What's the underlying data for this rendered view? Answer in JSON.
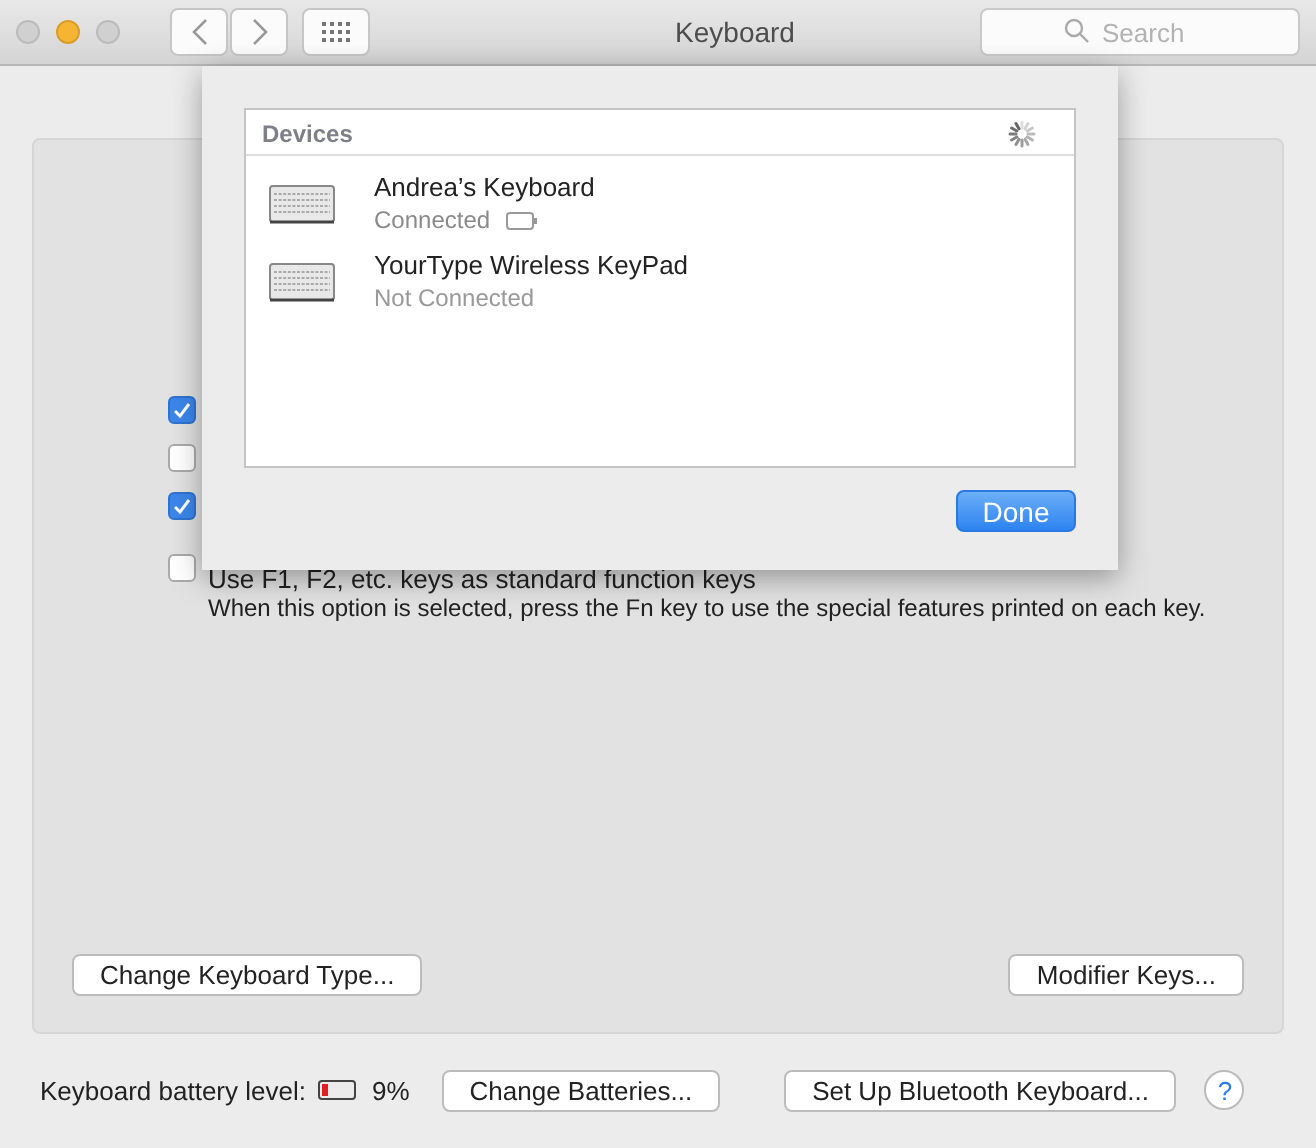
{
  "window": {
    "title": "Keyboard"
  },
  "search": {
    "placeholder": "Search"
  },
  "options": [
    {
      "checked": true
    },
    {
      "checked": false
    },
    {
      "checked": true
    },
    {
      "checked": false,
      "label": "Use F1, F2, etc. keys as standard function keys",
      "note": "When this option is selected, press the Fn key to use the special features printed on each key."
    }
  ],
  "panel_buttons": [
    "Change Keyboard Type...",
    "Modifier Keys..."
  ],
  "battery": {
    "label": "Keyboard battery level:",
    "level": 0.09,
    "reading": "9%"
  },
  "footer_buttons": [
    "Change Batteries...",
    "Set Up Bluetooth Keyboard..."
  ],
  "help": "?",
  "sheet": {
    "list_title": "Devices",
    "devices": [
      {
        "name": "Andrea’s Keyboard",
        "status": "Connected",
        "connected": true
      },
      {
        "name": "YourType Wireless KeyPad",
        "status": "Not Connected",
        "connected": false
      }
    ],
    "button": "Done"
  }
}
